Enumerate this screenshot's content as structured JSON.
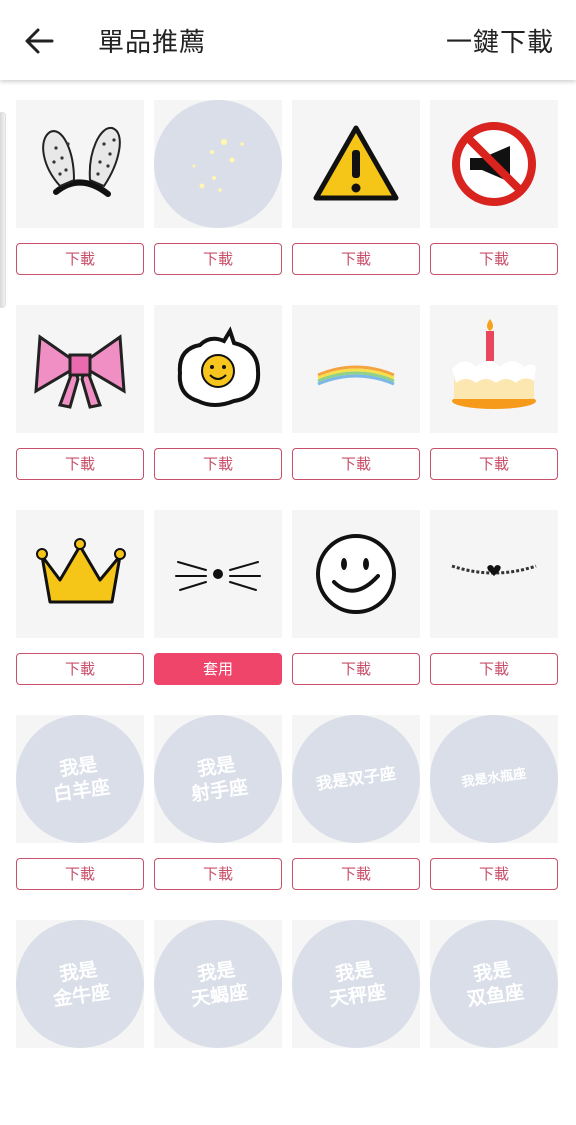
{
  "header": {
    "title": "單品推薦",
    "download_all": "一鍵下載"
  },
  "labels": {
    "download": "下載",
    "apply": "套用"
  },
  "zodiac": {
    "aries": "我是\n白羊座",
    "sagittarius": "我是\n射手座",
    "gemini": "我是双子座",
    "aquarius": "我是水瓶座",
    "taurus": "我是\n金牛座",
    "scorpio": "我是\n天蝎座",
    "libra": "我是\n天秤座",
    "pisces": "我是\n双鱼座"
  },
  "colors": {
    "accent": "#f0456a",
    "button_border": "#c8506a",
    "circle_bg": "#d9dee8"
  },
  "items": [
    {
      "icon": "bunny-ears-headband-icon",
      "button": "下載"
    },
    {
      "icon": "sparkle-circle-icon",
      "button": "下載"
    },
    {
      "icon": "warning-sign-icon",
      "button": "下載"
    },
    {
      "icon": "no-horn-sign-icon",
      "button": "下載"
    },
    {
      "icon": "pink-bow-icon",
      "button": "下載"
    },
    {
      "icon": "fried-egg-smiley-icon",
      "button": "下載"
    },
    {
      "icon": "rainbow-icon",
      "button": "下載"
    },
    {
      "icon": "birthday-cake-icon",
      "button": "下載"
    },
    {
      "icon": "crown-icon",
      "button": "下載"
    },
    {
      "icon": "cat-whiskers-icon",
      "button": "套用"
    },
    {
      "icon": "smiley-face-icon",
      "button": "下載"
    },
    {
      "icon": "heart-necklace-icon",
      "button": "下載"
    },
    {
      "icon": "aries-text-icon",
      "button": "下載"
    },
    {
      "icon": "sagittarius-text-icon",
      "button": "下載"
    },
    {
      "icon": "gemini-text-icon",
      "button": "下載"
    },
    {
      "icon": "aquarius-text-icon",
      "button": "下載"
    },
    {
      "icon": "taurus-text-icon"
    },
    {
      "icon": "scorpio-text-icon"
    },
    {
      "icon": "libra-text-icon"
    },
    {
      "icon": "pisces-text-icon"
    }
  ]
}
